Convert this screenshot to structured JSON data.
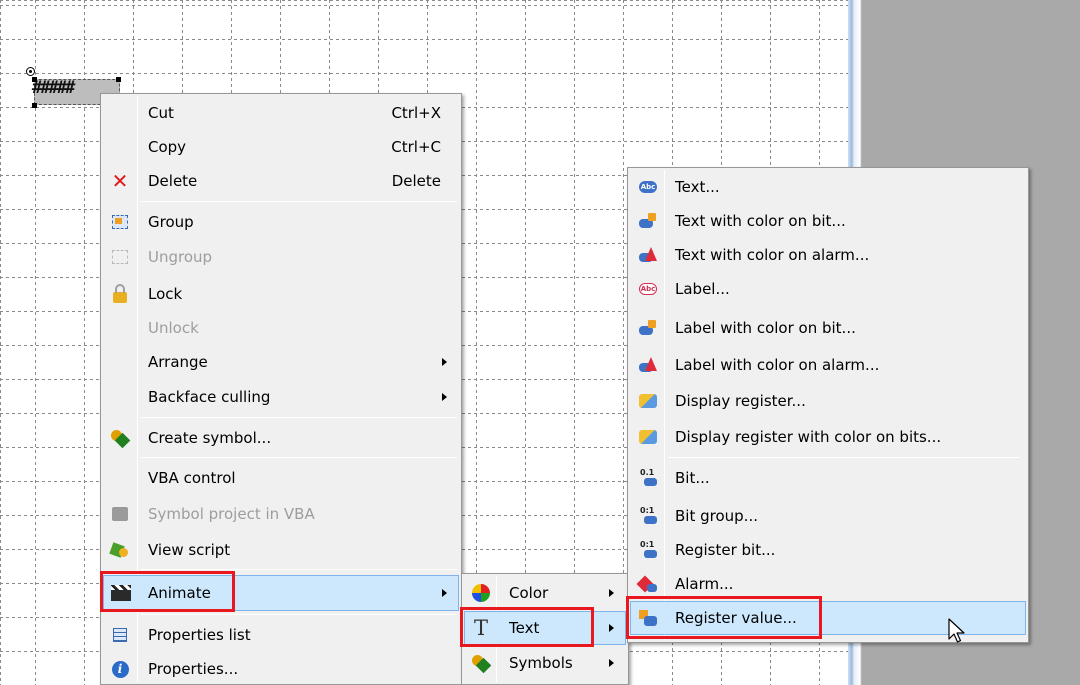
{
  "canvas": {
    "object_text": "#####"
  },
  "context_menu": {
    "items": [
      {
        "label": "Cut",
        "shortcut": "Ctrl+X",
        "icon": "none"
      },
      {
        "label": "Copy",
        "shortcut": "Ctrl+C",
        "icon": "none"
      },
      {
        "label": "Delete",
        "shortcut": "Delete",
        "icon": "delete-x-icon"
      },
      {
        "label": "Group",
        "shortcut": "",
        "icon": "group-icon"
      },
      {
        "label": "Ungroup",
        "shortcut": "",
        "icon": "ungroup-icon",
        "disabled": true
      },
      {
        "label": "Lock",
        "shortcut": "",
        "icon": "lock-icon"
      },
      {
        "label": "Unlock",
        "shortcut": "",
        "icon": "none",
        "disabled": true
      },
      {
        "label": "Arrange",
        "shortcut": "",
        "icon": "none",
        "submenu": true
      },
      {
        "label": "Backface culling",
        "shortcut": "",
        "icon": "none",
        "submenu": true
      },
      {
        "label": "Create symbol...",
        "shortcut": "",
        "icon": "create-symbol-icon"
      },
      {
        "label": "VBA control",
        "shortcut": "",
        "icon": "none"
      },
      {
        "label": "Symbol project in VBA",
        "shortcut": "",
        "icon": "symbol-project-icon",
        "disabled": true
      },
      {
        "label": "View script",
        "shortcut": "",
        "icon": "script-icon"
      },
      {
        "label": "Animate",
        "shortcut": "",
        "icon": "clapperboard-icon",
        "submenu": true,
        "active": true
      },
      {
        "label": "Properties list",
        "shortcut": "",
        "icon": "properties-list-icon"
      },
      {
        "label": "Properties...",
        "shortcut": "",
        "icon": "info-icon"
      }
    ]
  },
  "animate_submenu": {
    "items": [
      {
        "label": "Color",
        "icon": "color-wheel-icon"
      },
      {
        "label": "Text",
        "icon": "text-t-icon",
        "active": true
      },
      {
        "label": "Symbols",
        "icon": "symbols-icon"
      }
    ]
  },
  "text_submenu": {
    "items": [
      {
        "label": "Text...",
        "icon": "abc-text-icon"
      },
      {
        "label": "Text with color on bit...",
        "icon": "text-color-bit-icon"
      },
      {
        "label": "Text with color on alarm...",
        "icon": "text-color-alarm-icon"
      },
      {
        "label": "Label...",
        "icon": "label-icon"
      },
      {
        "label": "Label with color on bit...",
        "icon": "label-color-bit-icon"
      },
      {
        "label": "Label with color on alarm...",
        "icon": "label-color-alarm-icon"
      },
      {
        "label": "Display register...",
        "icon": "display-register-icon"
      },
      {
        "label": "Display register with color on bits...",
        "icon": "display-register-bits-icon"
      },
      {
        "label": "Bit...",
        "icon": "bit-icon"
      },
      {
        "label": "Bit group...",
        "icon": "bit-group-icon"
      },
      {
        "label": "Register bit...",
        "icon": "register-bit-icon"
      },
      {
        "label": "Alarm...",
        "icon": "alarm-icon"
      },
      {
        "label": "Register value...",
        "icon": "register-value-icon",
        "active": true
      }
    ]
  },
  "colors": {
    "highlight_box": "#e8181e",
    "menu_bg": "#f0f0f0",
    "hover_bg": "#cde8fd",
    "workspace": "#a9a9a9"
  }
}
